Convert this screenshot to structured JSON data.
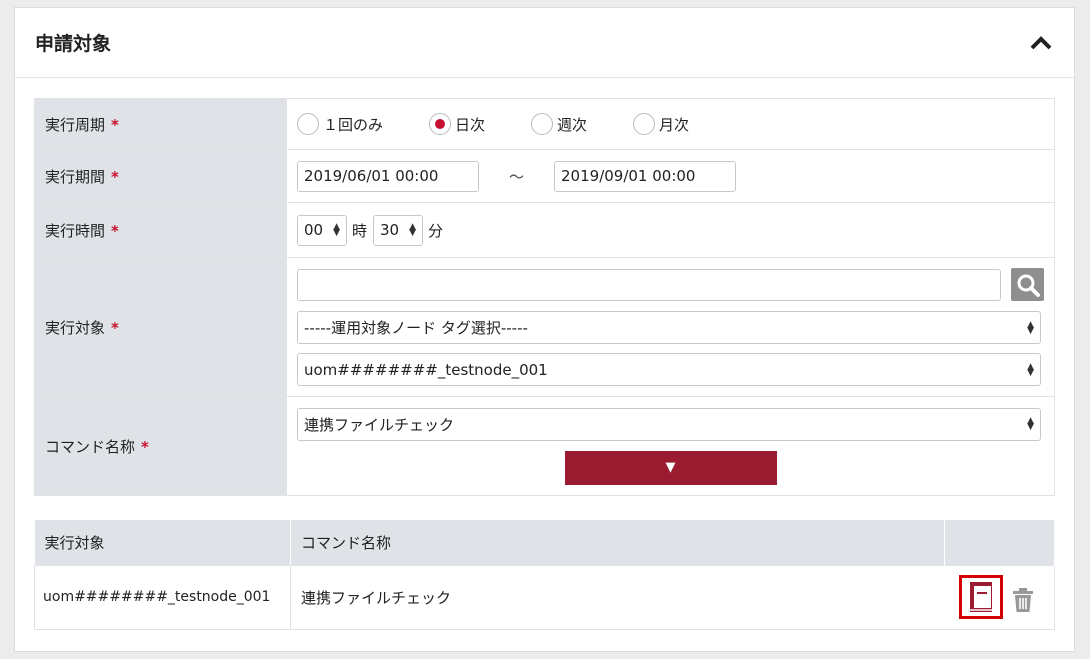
{
  "section": {
    "title": "申請対象"
  },
  "form": {
    "cycle": {
      "label": "実行周期",
      "required_mark": "*",
      "options": [
        {
          "label": "１回のみ",
          "checked": false
        },
        {
          "label": "日次",
          "checked": true
        },
        {
          "label": "週次",
          "checked": false
        },
        {
          "label": "月次",
          "checked": false
        }
      ]
    },
    "period": {
      "label": "実行期間",
      "required_mark": "*",
      "start_value": "2019/06/01 00:00",
      "separator": "～",
      "end_value": "2019/09/01 00:00"
    },
    "time": {
      "label": "実行時間",
      "required_mark": "*",
      "hour_value": "00",
      "hour_unit": "時",
      "minute_value": "30",
      "minute_unit": "分"
    },
    "target": {
      "label": "実行対象",
      "required_mark": "*",
      "search_value": "",
      "tag_select_value": "-----運用対象ノード タグ選択-----",
      "node_select_value": "uom########_testnode_001"
    },
    "command": {
      "label": "コマンド名称",
      "required_mark": "*",
      "select_value": "連携ファイルチェック",
      "add_button_label": "▼"
    }
  },
  "list": {
    "headers": [
      "実行対象",
      "コマンド名称"
    ],
    "rows": [
      {
        "target": "uom########_testnode_001",
        "command": "連携ファイルチェック"
      }
    ]
  },
  "icons": {
    "collapse": "chevron-up-icon",
    "search": "magnifier-icon",
    "copy": "document-icon",
    "delete": "trash-icon"
  },
  "colors": {
    "accent": "#9b1b30",
    "required": "#c8102e",
    "label_bg": "#dfe3e7",
    "highlight": "#d40000"
  }
}
